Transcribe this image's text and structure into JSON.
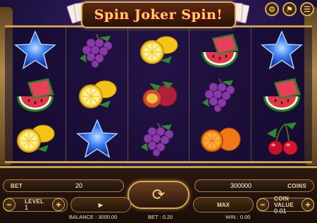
{
  "game": {
    "title": "Spin Joker Spin!"
  },
  "top_icons": [
    "gear-icon",
    "flag-icon",
    "menu-icon"
  ],
  "reels": [
    [
      "star",
      "watermelon",
      "lemon"
    ],
    [
      "grapes",
      "lemon",
      "star"
    ],
    [
      "lemon",
      "plum",
      "grapes"
    ],
    [
      "watermelon",
      "grapes",
      "orange"
    ],
    [
      "star",
      "watermelon",
      "cherry"
    ]
  ],
  "controls": {
    "bet_label": "BET",
    "bet_value": "20",
    "coins_value": "300000",
    "coins_label": "COINS",
    "level_label": "LEVEL",
    "level_value": "1",
    "coin_value_label": "COIN VALUE",
    "coin_value": "0.01",
    "max_label": "MAX"
  },
  "status": {
    "balance": "BALANCE : 3000.00",
    "bet": "BET : 0.20",
    "win": "WIN : 0.00"
  },
  "colors": {
    "gold": "#c9a04a",
    "background": "#24154a"
  }
}
